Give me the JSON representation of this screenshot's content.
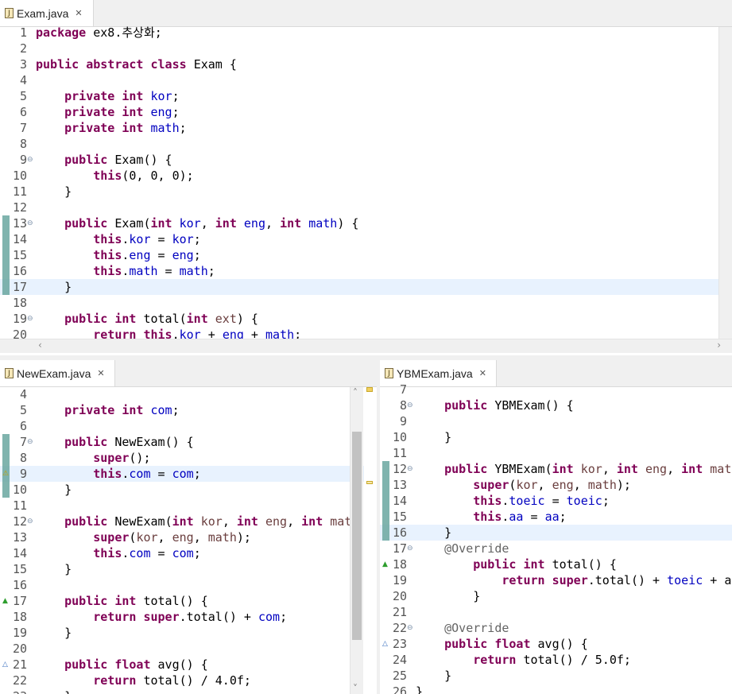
{
  "panes": {
    "top": {
      "file": "Exam.java"
    },
    "left": {
      "file": "NewExam.java"
    },
    "right": {
      "file": "YBMExam.java"
    }
  },
  "icons": {
    "file": "java-file-icon",
    "close": "close-icon",
    "fold": "fold-collapse-icon"
  },
  "colors": {
    "keyword": "#7f0055",
    "field": "#0000c0",
    "param": "#6a3e3e",
    "current_line": "#e8f2fe",
    "change_bar": "#6aa7a0"
  },
  "exam_lines": [
    {
      "n": "1",
      "text": "package ex8.추상화;"
    },
    {
      "n": "2",
      "text": ""
    },
    {
      "n": "3",
      "text": "public abstract class Exam {"
    },
    {
      "n": "4",
      "text": ""
    },
    {
      "n": "5",
      "text": "    private int kor;"
    },
    {
      "n": "6",
      "text": "    private int eng;"
    },
    {
      "n": "7",
      "text": "    private int math;"
    },
    {
      "n": "8",
      "text": ""
    },
    {
      "n": "9",
      "text": "    public Exam() {"
    },
    {
      "n": "10",
      "text": "        this(0, 0, 0);"
    },
    {
      "n": "11",
      "text": "    }"
    },
    {
      "n": "12",
      "text": ""
    },
    {
      "n": "13",
      "text": "    public Exam(int kor, int eng, int math) {"
    },
    {
      "n": "14",
      "text": "        this.kor = kor;"
    },
    {
      "n": "15",
      "text": "        this.eng = eng;"
    },
    {
      "n": "16",
      "text": "        this.math = math;"
    },
    {
      "n": "17",
      "text": "    }"
    },
    {
      "n": "18",
      "text": ""
    },
    {
      "n": "19",
      "text": "    public int total(int ext) {"
    },
    {
      "n": "20",
      "text": "        return this.kor + eng + math;"
    }
  ],
  "newexam_lines": [
    {
      "n": "4",
      "text": ""
    },
    {
      "n": "5",
      "text": "    private int com;"
    },
    {
      "n": "6",
      "text": ""
    },
    {
      "n": "7",
      "text": "    public NewExam() {"
    },
    {
      "n": "8",
      "text": "        super();"
    },
    {
      "n": "9",
      "text": "        this.com = com;"
    },
    {
      "n": "10",
      "text": "    }"
    },
    {
      "n": "11",
      "text": ""
    },
    {
      "n": "12",
      "text": "    public NewExam(int kor, int eng, int mat"
    },
    {
      "n": "13",
      "text": "        super(kor, eng, math);"
    },
    {
      "n": "14",
      "text": "        this.com = com;"
    },
    {
      "n": "15",
      "text": "    }"
    },
    {
      "n": "16",
      "text": ""
    },
    {
      "n": "17",
      "text": "    public int total() {"
    },
    {
      "n": "18",
      "text": "        return super.total() + com;"
    },
    {
      "n": "19",
      "text": "    }"
    },
    {
      "n": "20",
      "text": ""
    },
    {
      "n": "21",
      "text": "    public float avg() {"
    },
    {
      "n": "22",
      "text": "        return total() / 4.0f;"
    },
    {
      "n": "23",
      "text": "    }"
    }
  ],
  "ybm_lines": [
    {
      "n": "7",
      "text": ""
    },
    {
      "n": "8",
      "text": "    public YBMExam() {"
    },
    {
      "n": "9",
      "text": ""
    },
    {
      "n": "10",
      "text": "    }"
    },
    {
      "n": "11",
      "text": ""
    },
    {
      "n": "12",
      "text": "    public YBMExam(int kor, int eng, int mat"
    },
    {
      "n": "13",
      "text": "        super(kor, eng, math);"
    },
    {
      "n": "14",
      "text": "        this.toeic = toeic;"
    },
    {
      "n": "15",
      "text": "        this.aa = aa;"
    },
    {
      "n": "16",
      "text": "    }"
    },
    {
      "n": "17",
      "text": "    @Override"
    },
    {
      "n": "18",
      "text": "        public int total() {"
    },
    {
      "n": "19",
      "text": "            return super.total() + toeic + a"
    },
    {
      "n": "20",
      "text": "        }"
    },
    {
      "n": "21",
      "text": ""
    },
    {
      "n": "22",
      "text": "    @Override"
    },
    {
      "n": "23",
      "text": "    public float avg() {"
    },
    {
      "n": "24",
      "text": "        return total() / 5.0f;"
    },
    {
      "n": "25",
      "text": "    }"
    },
    {
      "n": "26",
      "text": "}"
    }
  ]
}
